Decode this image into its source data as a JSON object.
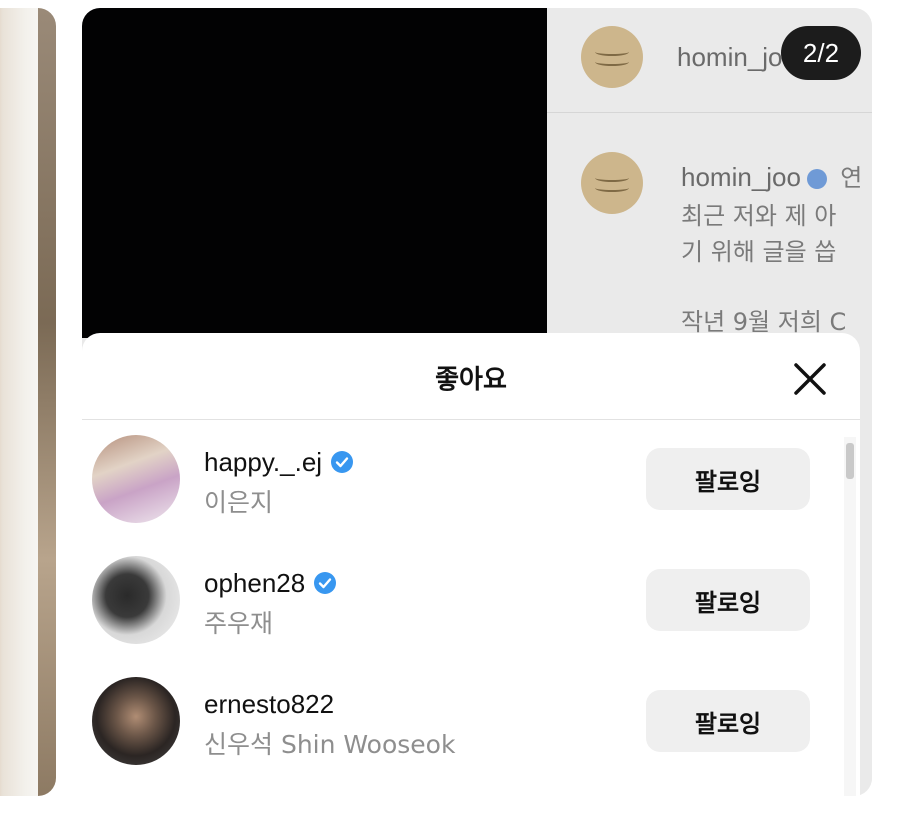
{
  "background_post": {
    "page_indicator": "2/2",
    "comments": [
      {
        "username": "homin_jo",
        "text": ""
      },
      {
        "username": "homin_joo",
        "lines": [
          "연",
          "최근 저와 제 아",
          "기 위해 글을 씁",
          "",
          "작년 9월 저희 C"
        ]
      }
    ]
  },
  "likes_modal": {
    "title": "좋아요",
    "close_icon": "close-icon",
    "users": [
      {
        "username": "happy._.ej",
        "full_name": "이은지",
        "verified": true,
        "button_label": "팔로잉"
      },
      {
        "username": "ophen28",
        "full_name": "주우재",
        "verified": true,
        "button_label": "팔로잉"
      },
      {
        "username": "ernesto822",
        "full_name": "신우석 Shin Wooseok",
        "verified": false,
        "button_label": "팔로잉"
      }
    ]
  },
  "colors": {
    "verified_blue": "#3897f0",
    "button_bg": "#efefef",
    "secondary_text": "#8e8e8e",
    "page_indicator_bg": "#1c1c1c"
  }
}
